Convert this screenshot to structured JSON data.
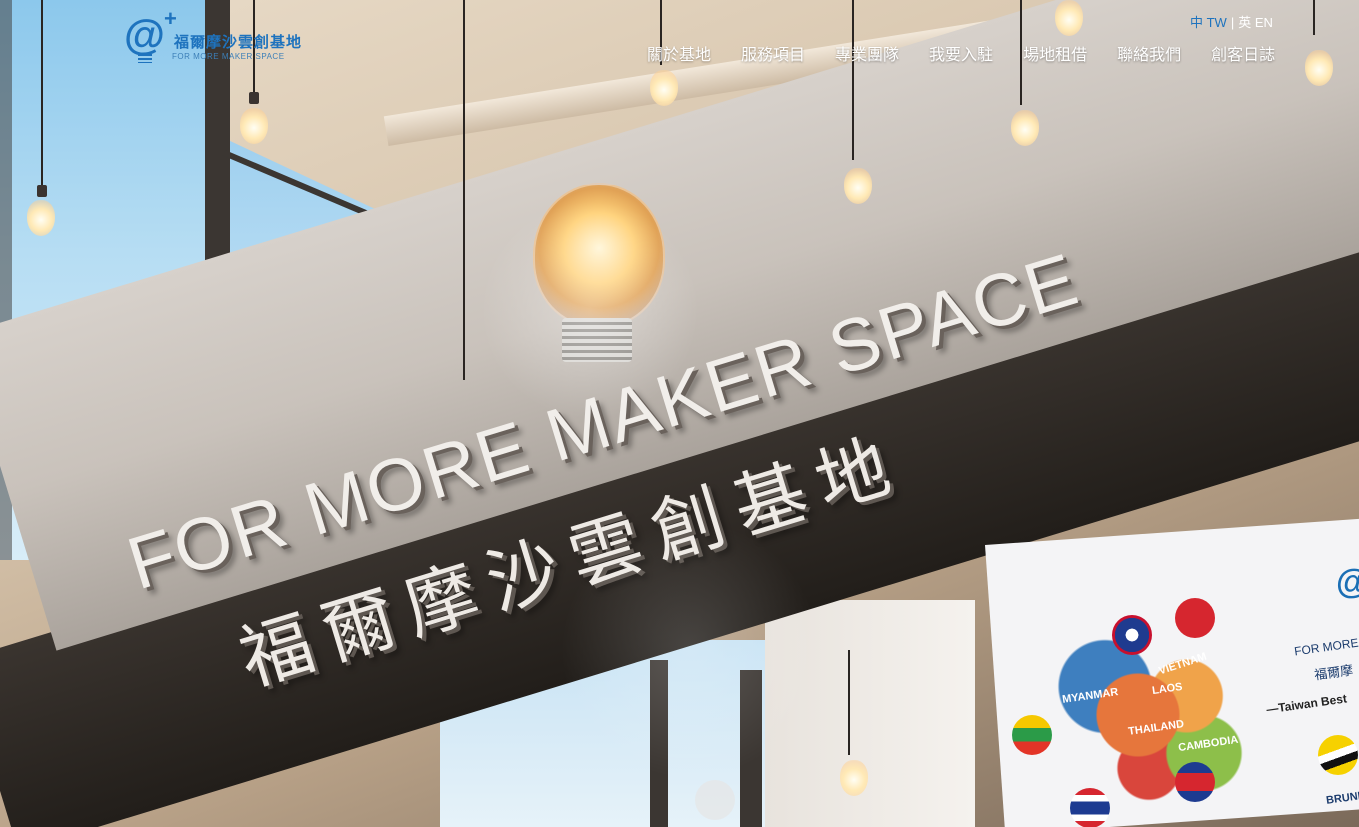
{
  "brand": {
    "name_zh": "福爾摩沙雲創基地",
    "name_en": "FOR MORE MAKER SPACE",
    "logo_icon": "at-plus-bulb-icon",
    "color": "#1e73be"
  },
  "language": {
    "current": "中 TW",
    "separator": "|",
    "other": "英 EN"
  },
  "nav": {
    "items": [
      {
        "label": "關於基地"
      },
      {
        "label": "服務項目"
      },
      {
        "label": "專業團隊"
      },
      {
        "label": "我要入駐"
      },
      {
        "label": "場地租借"
      },
      {
        "label": "聯絡我們"
      },
      {
        "label": "創客日誌"
      }
    ]
  },
  "hero": {
    "sign_en": "FOR MORE MAKER SPACE",
    "sign_zh": "福爾摩沙雲創基地",
    "poster": {
      "countries": [
        "MYANMAR",
        "LAOS",
        "VIETNAM",
        "THAILAND",
        "CAMBODIA",
        "BRUNEI"
      ],
      "side_text_1": "FOR MORE",
      "side_text_2": "福爾摩",
      "side_text_3": "—Taiwan Best"
    }
  }
}
